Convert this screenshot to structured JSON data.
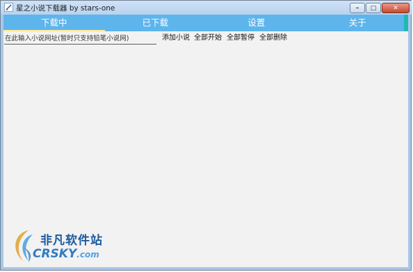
{
  "window": {
    "title": "星之小说下载器 by stars-one",
    "min_symbol": "–",
    "max_symbol": "□",
    "close_symbol": "✕"
  },
  "tabs": [
    {
      "label": "下载中",
      "active": true
    },
    {
      "label": "已下载",
      "active": false
    },
    {
      "label": "设置",
      "active": false
    },
    {
      "label": "关于",
      "active": false
    }
  ],
  "toolbar": {
    "url_placeholder": "在此输入小说网址(暂时只支持铅笔小说网)",
    "url_value": "",
    "add_label": "添加小说",
    "start_all_label": "全部开始",
    "pause_all_label": "全部暂停",
    "delete_all_label": "全部删除"
  },
  "watermark": {
    "cn": "非凡软件站",
    "en": "CRSKY",
    "suffix": ".com"
  },
  "colors": {
    "tab_bar": "#5db5ec",
    "active_underline": "#ffe69a",
    "tab_accent": "#1fb9b2",
    "content_bg": "#f2f2f2"
  }
}
